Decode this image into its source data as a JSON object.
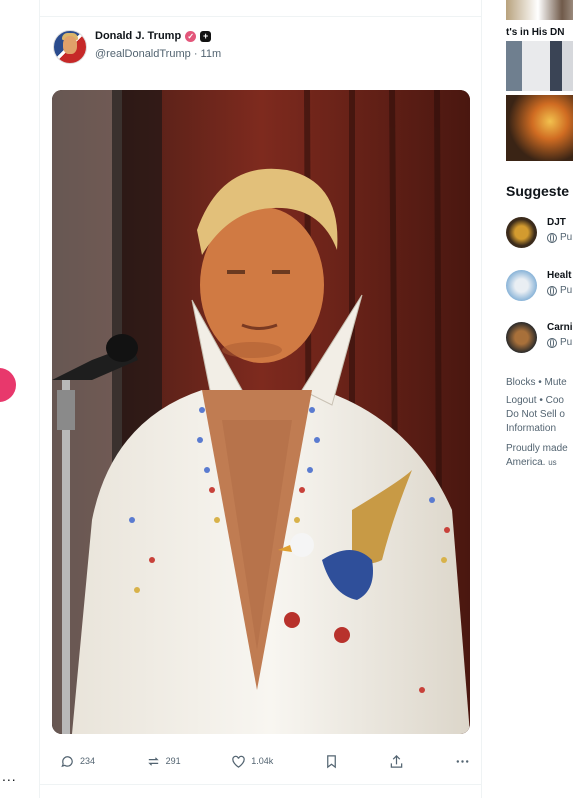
{
  "post": {
    "author_name": "Donald J. Trump",
    "verified_icon": "verified-badge-icon",
    "plus_icon": "plus-badge-icon",
    "handle": "@realDonaldTrump",
    "separator": "·",
    "time": "11m",
    "image_alt": "Donald Trump in white jeweled jumpsuit with eagle at microphone"
  },
  "actions": {
    "reply_count": "234",
    "repost_count": "291",
    "like_count": "1.04k"
  },
  "left": {
    "more": "..."
  },
  "sidebar": {
    "trending_caption": "t's in His DN",
    "suggested_heading": "Suggeste",
    "suggestions": [
      {
        "name": "DJT",
        "sub": "Pu",
        "avatar_colors": [
          "#3b2b1b",
          "#d39b2f"
        ]
      },
      {
        "name": "Healt",
        "sub": "Pu",
        "avatar_colors": [
          "#8ab4d8",
          "#e9eef3"
        ]
      },
      {
        "name": "Carni",
        "sub": "Pu",
        "avatar_colors": [
          "#2b2b2b",
          "#a8703a"
        ]
      }
    ],
    "footer": {
      "line1": "Blocks • Mute",
      "line2": "Logout • Coo",
      "line3": "Do Not Sell o",
      "line4": "Information",
      "line5": "Proudly made",
      "line6_a": "America.",
      "line6_b": "us"
    }
  },
  "colors": {
    "accent_pink": "#e8386c",
    "text_secondary": "#536471",
    "divider": "#eff3f4"
  }
}
